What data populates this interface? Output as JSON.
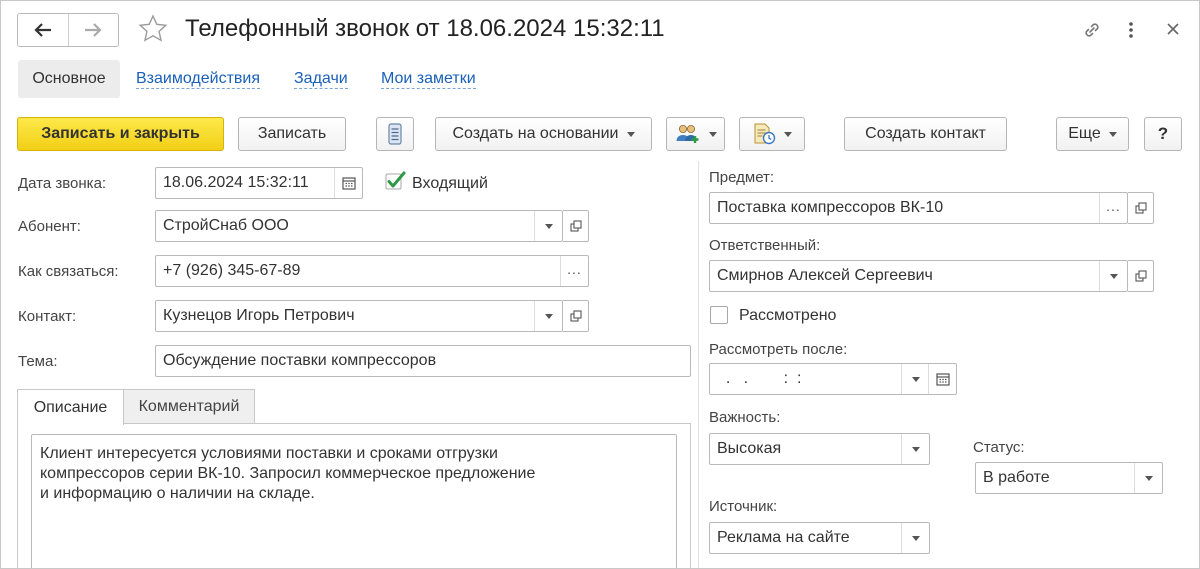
{
  "header": {
    "title": "Телефонный звонок от 18.06.2024 15:32:11"
  },
  "tabs": [
    "Основное",
    "Взаимодействия",
    "Задачи",
    "Мои заметки"
  ],
  "toolbar": {
    "save_close": "Записать и закрыть",
    "save": "Записать",
    "create_based_on": "Создать на основании",
    "create_contact": "Создать контакт",
    "more": "Еще",
    "help": "?"
  },
  "form": {
    "call_date": {
      "label": "Дата звонка:",
      "value": "18.06.2024 15:32:11"
    },
    "incoming": {
      "label": "Входящий",
      "checked": true
    },
    "subscriber": {
      "label": "Абонент:",
      "value": "СтройСнаб ООО"
    },
    "how_contact": {
      "label": "Как связаться:",
      "value": "+7 (926) 345-67-89"
    },
    "contact": {
      "label": "Контакт:",
      "value": "Кузнецов Игорь Петрович"
    },
    "topic": {
      "label": "Тема:",
      "value": "Обсуждение поставки компрессоров"
    },
    "subject": {
      "label": "Предмет:",
      "value": "Поставка компрессоров ВК-10"
    },
    "responsible": {
      "label": "Ответственный:",
      "value": "Смирнов Алексей Сергеевич"
    },
    "reviewed": {
      "label": "Рассмотрено",
      "checked": false
    },
    "review_after": {
      "label": "Рассмотреть после:",
      "value": "  .   .        :  :"
    },
    "importance": {
      "label": "Важность:",
      "value": "Высокая"
    },
    "status": {
      "label": "Статус:",
      "value": "В работе"
    },
    "source": {
      "label": "Источник:",
      "value": "Реклама на сайте"
    }
  },
  "inner_tabs": [
    "Описание",
    "Комментарий"
  ],
  "description": [
    "Клиент интересуется условиями поставки и сроками отгрузки",
    "компрессоров серии ВК-10. Запросил коммерческое предложение",
    "и информацию о наличии на складе."
  ],
  "colors": {
    "primary_button": "#f5d41f",
    "link": "#1a60b8",
    "checkmark": "#2e9a48"
  }
}
